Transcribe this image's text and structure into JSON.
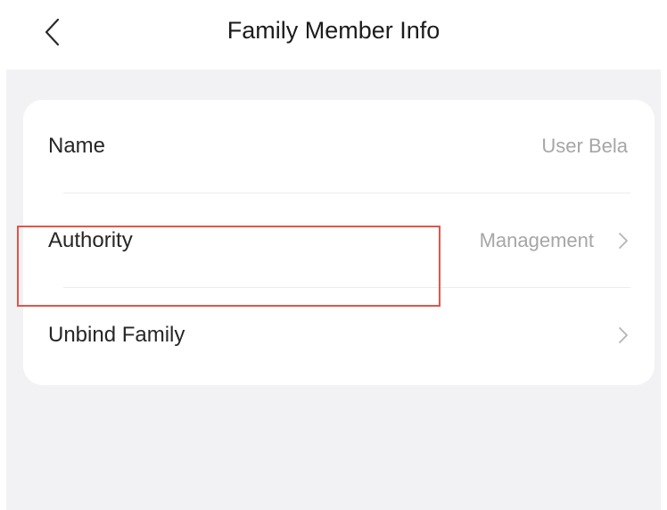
{
  "header": {
    "title": "Family Member Info",
    "back_icon": "chevron-left-icon"
  },
  "member_info": {
    "rows": [
      {
        "label": "Name",
        "value": "User Bela"
      },
      {
        "label": "Authority",
        "value": "Management",
        "chevron_icon": "chevron-right-icon"
      },
      {
        "label": "Unbind Family",
        "value": "",
        "chevron_icon": "chevron-right-icon"
      }
    ]
  },
  "colors": {
    "background": "#f2f2f4",
    "card": "#ffffff",
    "label_text": "#262626",
    "value_text": "#a6a6a6",
    "highlight_border": "#e2554a"
  }
}
